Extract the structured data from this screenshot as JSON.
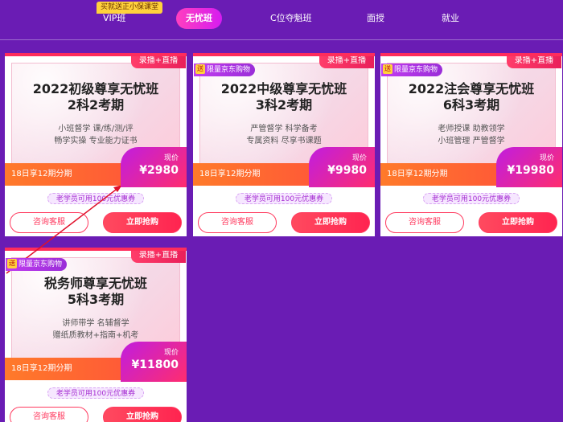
{
  "nav": {
    "promo_badge": "买就送正小保课堂",
    "tabs": [
      {
        "label": "VIP班"
      },
      {
        "label": "无忧班"
      },
      {
        "label": "C位夺魁班"
      },
      {
        "label": "面授"
      },
      {
        "label": "就业"
      }
    ],
    "active_tab": "无忧班"
  },
  "cards": [
    {
      "live_tag": "录播+直播",
      "jd_tag": "",
      "title_line1": "2022初级尊享无忧班",
      "title_line2": "2科2考期",
      "features_line1": "小班督学  课/练/测/评",
      "features_line2": "畅学实操  专业能力证书",
      "install": "18日享12期分期",
      "price_label": "现价",
      "price": "¥2980",
      "coupon": "老学员可用100元优惠券",
      "consult": "咨询客服",
      "buy": "立即抢购"
    },
    {
      "live_tag": "录播+直播",
      "jd_tag": "限量京东购物",
      "title_line1": "2022中级尊享无忧班",
      "title_line2": "3科2考期",
      "features_line1": "严管督学  科学备考",
      "features_line2": "专属资料  尽享书课题",
      "install": "18日享12期分期",
      "price_label": "现价",
      "price": "¥9980",
      "coupon": "老学员可用100元优惠券",
      "consult": "咨询客服",
      "buy": "立即抢购"
    },
    {
      "live_tag": "录播+直播",
      "jd_tag": "限量京东购物",
      "title_line1": "2022注会尊享无忧班",
      "title_line2": "6科3考期",
      "features_line1": "老师授课  助教领学",
      "features_line2": "小班管理  严管督学",
      "install": "18日享12期分期",
      "price_label": "现价",
      "price": "¥19980",
      "coupon": "老学员可用100元优惠券",
      "consult": "咨询客服",
      "buy": "立即抢购"
    },
    {
      "live_tag": "录播+直播",
      "jd_tag": "限量京东购物",
      "title_line1": "税务师尊享无忧班",
      "title_line2": "5科3考期",
      "features_line1": "讲师带学  名辅督学",
      "features_line2": "赠纸质教材+指南+机考",
      "install": "18日享12期分期",
      "price_label": "现价",
      "price": "¥11800",
      "coupon": "老学员可用100元优惠券",
      "consult": "咨询客服",
      "buy": "立即抢购"
    }
  ],
  "song_glyph": "送",
  "colors": {
    "background": "#6a1cb4",
    "accent_red": "#ff3a5f",
    "price_gradient_start": "#c01de0",
    "price_gradient_end": "#ff2d6e",
    "promo_yellow": "#ffd23c",
    "annotation_arrow": "#e0102a"
  }
}
